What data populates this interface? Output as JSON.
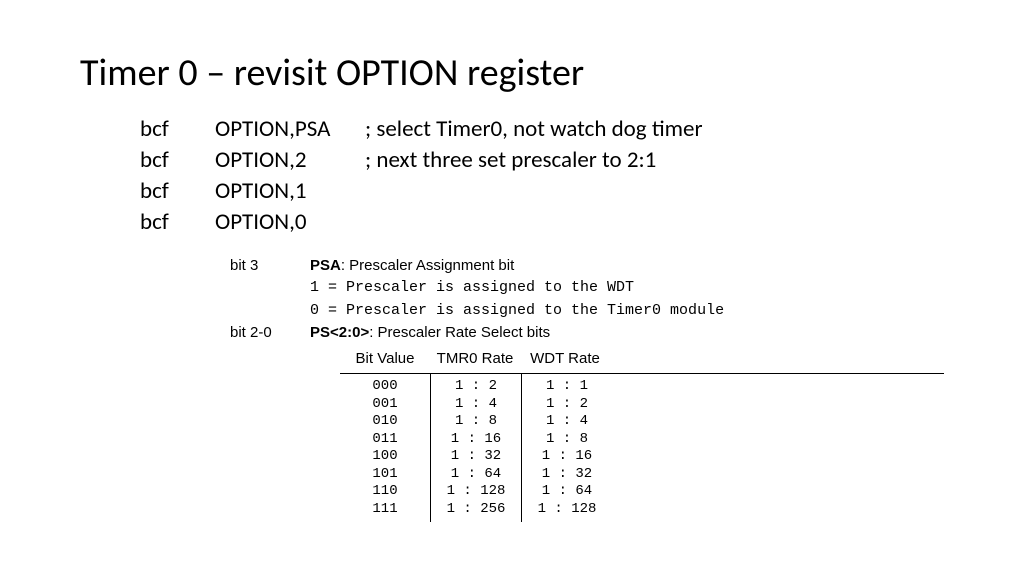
{
  "title": "Timer 0 – revisit OPTION register",
  "code": [
    {
      "mnemonic": "bcf",
      "operand": "OPTION,PSA",
      "comment": "; select Timer0, not watch dog timer"
    },
    {
      "mnemonic": "bcf",
      "operand": "OPTION,2",
      "comment": "; next three set prescaler to 2:1"
    },
    {
      "mnemonic": "bcf",
      "operand": "OPTION,1",
      "comment": ""
    },
    {
      "mnemonic": "bcf",
      "operand": "OPTION,0",
      "comment": ""
    }
  ],
  "bit3": {
    "label": "bit 3",
    "name": "PSA",
    "desc": ": Prescaler Assignment bit",
    "line1": "1 = Prescaler is assigned to the WDT",
    "line0": "0 = Prescaler is assigned to the Timer0 module"
  },
  "bit20": {
    "label": "bit 2-0",
    "name": "PS<2:0>",
    "desc": ": Prescaler Rate Select bits"
  },
  "rate_headers": {
    "c1": "Bit Value",
    "c2": "TMR0 Rate",
    "c3": "WDT Rate"
  },
  "rates": [
    {
      "bits": "000",
      "tmr0": "1 : 2",
      "wdt": "1 : 1"
    },
    {
      "bits": "001",
      "tmr0": "1 : 4",
      "wdt": "1 : 2"
    },
    {
      "bits": "010",
      "tmr0": "1 : 8",
      "wdt": "1 : 4"
    },
    {
      "bits": "011",
      "tmr0": "1 : 16",
      "wdt": "1 : 8"
    },
    {
      "bits": "100",
      "tmr0": "1 : 32",
      "wdt": "1 : 16"
    },
    {
      "bits": "101",
      "tmr0": "1 : 64",
      "wdt": "1 : 32"
    },
    {
      "bits": "110",
      "tmr0": "1 : 128",
      "wdt": "1 : 64"
    },
    {
      "bits": "111",
      "tmr0": "1 : 256",
      "wdt": "1 : 128"
    }
  ]
}
